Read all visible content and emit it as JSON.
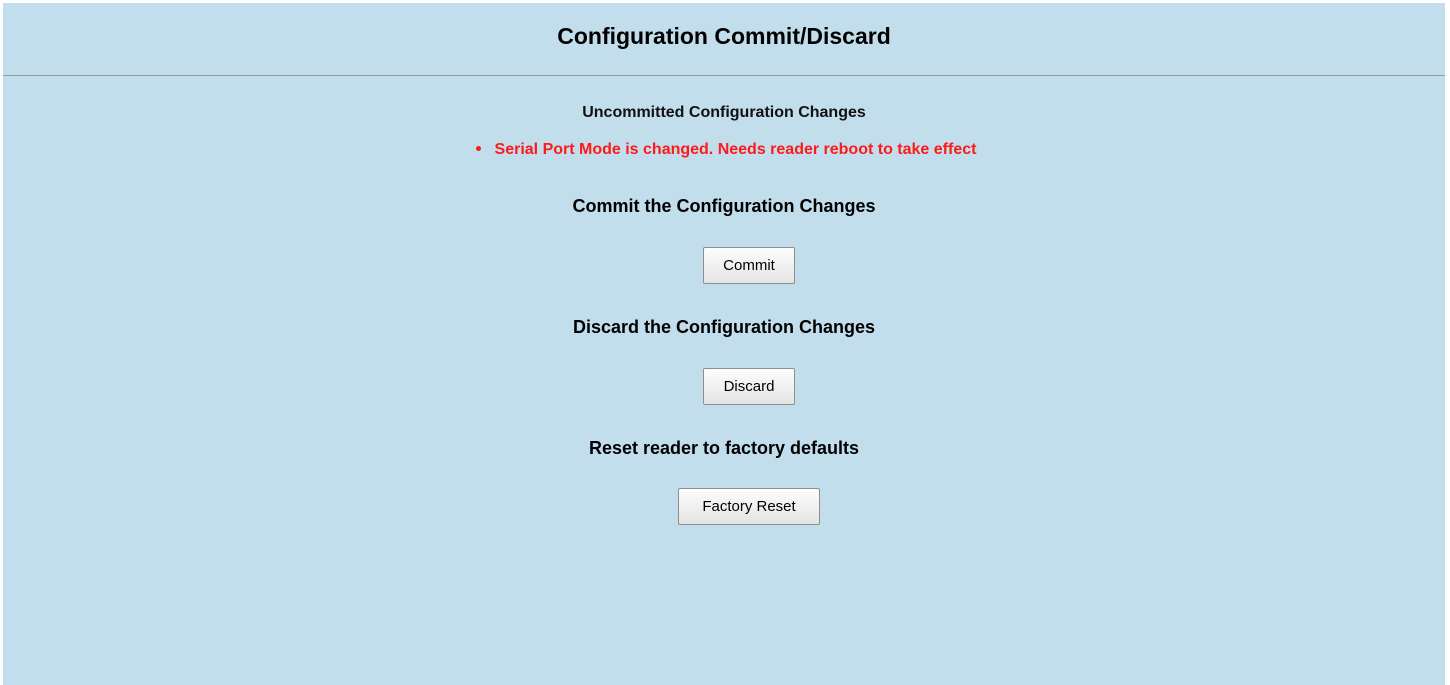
{
  "header": {
    "title": "Configuration Commit/Discard"
  },
  "changes": {
    "heading": "Uncommitted Configuration Changes",
    "items": [
      "Serial Port Mode is changed. Needs reader reboot to take effect"
    ]
  },
  "commit": {
    "heading": "Commit the Configuration Changes",
    "button_label": "Commit"
  },
  "discard": {
    "heading": "Discard the Configuration Changes",
    "button_label": "Discard"
  },
  "reset": {
    "heading": "Reset reader to factory defaults",
    "button_label": "Factory Reset"
  },
  "colors": {
    "background": "#c2deec",
    "warning_text": "#ff1a1a",
    "divider": "#9a9a9a"
  }
}
